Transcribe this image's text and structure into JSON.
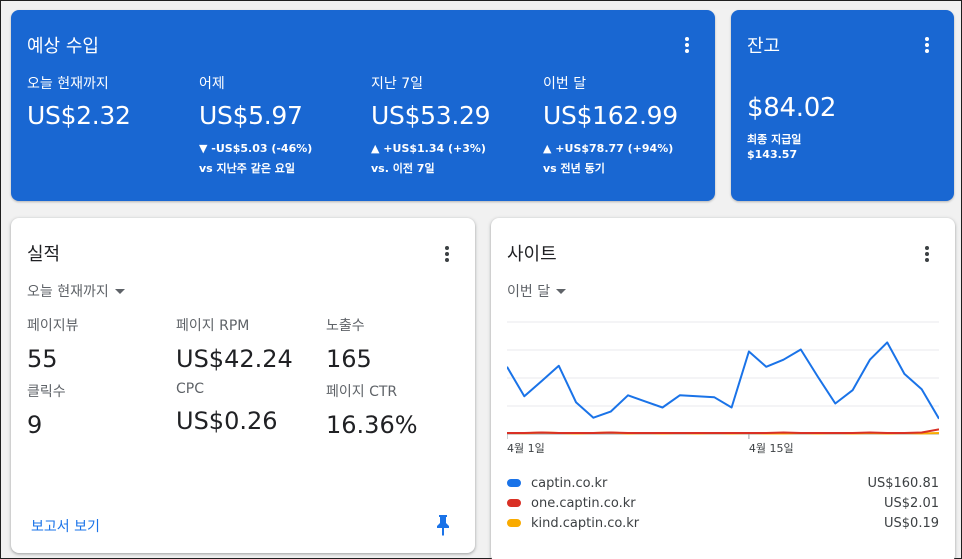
{
  "estimated_earnings": {
    "title": "예상 수입",
    "metrics": [
      {
        "label": "오늘 현재까지",
        "value": "US$2.32",
        "delta": "",
        "comparison": ""
      },
      {
        "label": "어제",
        "value": "US$5.97",
        "delta": "▼ -US$5.03 (-46%)",
        "comparison": "vs 지난주 같은 요일"
      },
      {
        "label": "지난 7일",
        "value": "US$53.29",
        "delta": "▲ +US$1.34 (+3%)",
        "comparison": "vs. 이전 7일"
      },
      {
        "label": "이번 달",
        "value": "US$162.99",
        "delta": "▲ +US$78.77 (+94%)",
        "comparison": "vs 전년 동기"
      }
    ]
  },
  "balance": {
    "title": "잔고",
    "value": "$84.02",
    "last_payment_label": "최종 지급일",
    "last_payment_amount": "$143.57"
  },
  "performance": {
    "title": "실적",
    "period": "오늘 현재까지",
    "metrics": [
      {
        "label": "페이지뷰",
        "value": "55"
      },
      {
        "label": "페이지 RPM",
        "value": "US$42.24"
      },
      {
        "label": "노출수",
        "value": "165"
      },
      {
        "label": "클릭수",
        "value": "9"
      },
      {
        "label": "CPC",
        "value": "US$0.26"
      },
      {
        "label": "페이지 CTR",
        "value": "16.36%"
      }
    ],
    "report_link": "보고서 보기",
    "pin_icon": "pin-icon"
  },
  "sites": {
    "title": "사이트",
    "period": "이번 달",
    "legend": [
      {
        "name": "captin.co.kr",
        "value": "US$160.81",
        "color": "#1a73e8"
      },
      {
        "name": "one.captin.co.kr",
        "value": "US$2.01",
        "color": "#d93025"
      },
      {
        "name": "kind.captin.co.kr",
        "value": "US$0.19",
        "color": "#f9ab00"
      }
    ]
  },
  "chart_data": {
    "type": "line",
    "title": "",
    "xlabel": "",
    "ylabel": "",
    "x_tick_labels": [
      "4월 1일",
      "4월 15일"
    ],
    "x_tick_index": [
      0,
      14
    ],
    "x": [
      1,
      2,
      3,
      4,
      5,
      6,
      7,
      8,
      9,
      10,
      11,
      12,
      13,
      14,
      15,
      16,
      17,
      18,
      19,
      20,
      21,
      22,
      23,
      24,
      25,
      26
    ],
    "ylim": [
      0,
      11
    ],
    "grid": true,
    "series": [
      {
        "name": "captin.co.kr",
        "color": "#1a73e8",
        "values": [
          6.6,
          3.7,
          5.2,
          6.7,
          3.1,
          1.6,
          2.2,
          3.8,
          3.2,
          2.6,
          3.8,
          3.7,
          3.6,
          2.6,
          8.1,
          6.6,
          7.3,
          8.3,
          5.6,
          3.0,
          4.3,
          7.3,
          9.0,
          5.9,
          4.4,
          1.5
        ]
      },
      {
        "name": "one.captin.co.kr",
        "color": "#d93025",
        "values": [
          0.1,
          0.1,
          0.15,
          0.1,
          0.1,
          0.1,
          0.15,
          0.1,
          0.1,
          0.1,
          0.1,
          0.1,
          0.1,
          0.1,
          0.1,
          0.1,
          0.15,
          0.1,
          0.1,
          0.1,
          0.1,
          0.15,
          0.1,
          0.1,
          0.15,
          0.45
        ]
      },
      {
        "name": "kind.captin.co.kr",
        "color": "#f9ab00",
        "values": [
          0.1,
          0.08,
          0.15,
          0.1,
          0.05,
          0.1,
          0.15,
          0.05,
          0.1,
          0.05,
          0.1,
          0.05,
          0.1,
          0.05,
          0.1,
          0.05,
          0.05,
          0.1,
          0.05,
          0.1,
          0.05,
          0.1,
          0.05,
          0.1,
          0.05,
          0.1
        ]
      }
    ]
  }
}
